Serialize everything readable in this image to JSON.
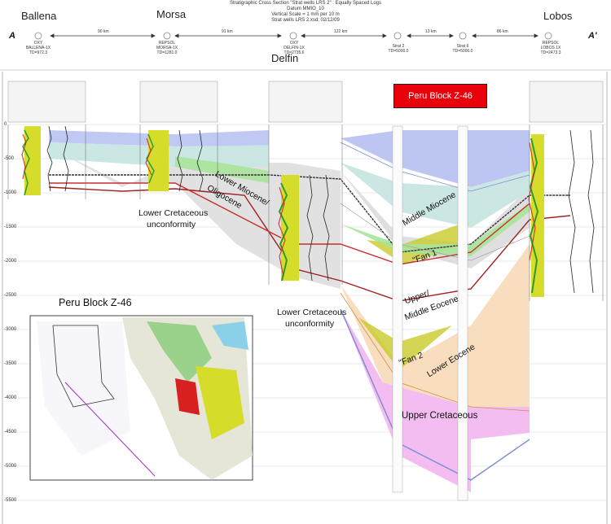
{
  "header": {
    "title": "Stratigraphic Cross Section \"Strat wells LRS 2\" : Equally Spaced Logs",
    "datum": "Datum MMIO_10",
    "vscale": "Vertical Scale = 1 mm per 10 m",
    "file": "Strat wells LRS 2.xsd; 02/12/09"
  },
  "section_ends": {
    "left": "A",
    "right": "A'"
  },
  "well_names": {
    "ballena": "Ballena",
    "morsa": "Morsa",
    "delfin": "Delfin",
    "lobos": "Lobos"
  },
  "wells": [
    {
      "l1": "OXY",
      "l2": "BALLENA-1X",
      "l3": "TD=972.3"
    },
    {
      "l1": "REPSOL",
      "l2": "MORSA-1X",
      "l3": "TD=1281.0"
    },
    {
      "l1": "OXY",
      "l2": "DELFIN-1X",
      "l3": "TD=2735.6"
    },
    {
      "l1": "",
      "l2": "Strat 2",
      "l3": "TD=5000.0"
    },
    {
      "l1": "",
      "l2": "Strat 6",
      "l3": "TD=5000.0"
    },
    {
      "l1": "REPSOL",
      "l2": "LOBOS 1X",
      "l3": "TD=2473.3"
    }
  ],
  "distances": [
    "90 km",
    "91 km",
    "122 km",
    "13 km",
    "86 km"
  ],
  "title_box": "Peru  Block Z-46",
  "inset_title": "Peru Block Z-46",
  "formations": {
    "lower_cret_1a": "Lower Cretaceous",
    "lower_cret_1b": "unconformity",
    "lower_miocene_a": "Lower Miocene/",
    "lower_miocene_b": "Oligocene",
    "lower_cret_2a": "Lower Cretaceous",
    "lower_cret_2b": "unconformity",
    "middle_miocene": "Middle Miocene",
    "fan1": "\"Fan 1",
    "upper_middle_eocene_a": "Upper/",
    "upper_middle_eocene_b": "Middle Eocene",
    "fan2": "\"Fan 2",
    "lower_eocene": "Lower Eocene",
    "upper_cretaceous": "Upper Cretaceous"
  },
  "depth_ticks": [
    "0",
    "-500",
    "-1000",
    "-1500",
    "-2000",
    "-2500",
    "-3000",
    "-3500",
    "-4000",
    "-4500",
    "-5000",
    "-5500"
  ],
  "colors": {
    "title_box": "#e8000b",
    "middle_miocene": "#b9c3f2",
    "teal_band": "#c7e6e3",
    "green_band": "#a9e39a",
    "gray_fill": "#dcdcdc",
    "fan_yellow": "#c9c92a",
    "lower_eocene": "#f8d9b8",
    "upper_cretaceous": "#f3b6f0",
    "log_yellow": "#d6dc2a",
    "log_green": "#2e9a2e",
    "log_red": "#d82020"
  }
}
